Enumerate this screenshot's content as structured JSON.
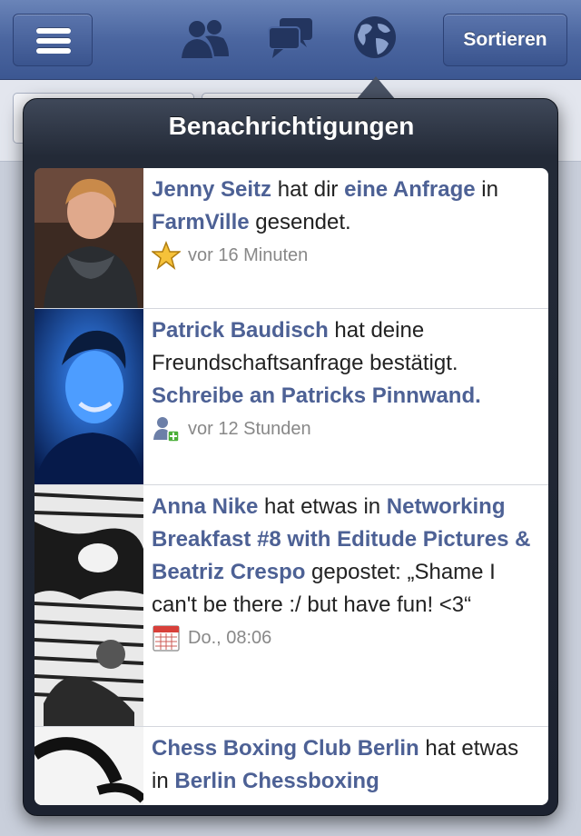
{
  "navbar": {
    "menu_icon": "hamburger-icon",
    "friends_icon": "friends-icon",
    "messages_icon": "messages-icon",
    "notifications_icon": "globe-icon",
    "sort_label": "Sortieren"
  },
  "popover": {
    "title": "Benachrichtigungen"
  },
  "notifications": [
    {
      "parts": [
        {
          "t": "Jenny Seitz",
          "link": true
        },
        {
          "t": " hat dir ",
          "link": false
        },
        {
          "t": "eine Anfrage",
          "link": true
        },
        {
          "t": " in ",
          "link": false
        },
        {
          "t": "FarmVille",
          "link": true
        },
        {
          "t": " gesendet.",
          "link": false
        }
      ],
      "icon": "star-icon",
      "time": "vor 16 Minuten"
    },
    {
      "parts": [
        {
          "t": "Patrick Baudisch",
          "link": true
        },
        {
          "t": " hat deine Freundschaftsanfrage bestätigt. ",
          "link": false
        },
        {
          "t": "Schreibe an Patricks Pinnwand.",
          "link": true
        }
      ],
      "icon": "friend-add-icon",
      "time": "vor 12 Stunden"
    },
    {
      "parts": [
        {
          "t": "Anna Nike",
          "link": true
        },
        {
          "t": " hat etwas in ",
          "link": false
        },
        {
          "t": "Networking Breakfast #8 with Editude Pictures & Beatriz Crespo",
          "link": true
        },
        {
          "t": " gepostet: „Shame I can't be there :/ but have fun! <3“",
          "link": false
        }
      ],
      "icon": "calendar-icon",
      "time": "Do., 08:06"
    },
    {
      "parts": [
        {
          "t": "Chess Boxing Club Berlin",
          "link": true
        },
        {
          "t": " hat etwas in ",
          "link": false
        },
        {
          "t": "Berlin Chessboxing",
          "link": true
        }
      ],
      "icon": "",
      "time": ""
    }
  ]
}
